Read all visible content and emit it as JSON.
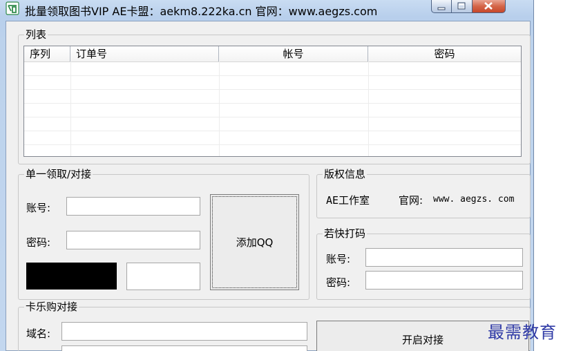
{
  "window": {
    "title": "批量领取图书VIP  AE卡盟：aekm8.222ka.cn  官网：www.aegzs.com",
    "min_icon": "minimize-icon",
    "max_icon": "maximize-icon",
    "close_icon": "close-icon",
    "app_icon": "app-logo-icon"
  },
  "list_group": {
    "legend": "列表",
    "columns": [
      "序列",
      "订单号",
      "帐号",
      "密码"
    ]
  },
  "single_group": {
    "legend": "单一领取/对接",
    "account_label": "账号:",
    "account_value": "",
    "password_label": "密码:",
    "password_value": "",
    "captcha_value": "",
    "add_button": "添加QQ"
  },
  "copyright_group": {
    "legend": "版权信息",
    "studio": "AE工作室",
    "site_label": "官网:",
    "site_url": "www. aegzs. com"
  },
  "ruokuai_group": {
    "legend": "若快打码",
    "account_label": "账号:",
    "account_value": "",
    "password_label": "密码:",
    "password_value": ""
  },
  "kalegou_group": {
    "legend": "卡乐购对接",
    "domain_label": "域名:",
    "domain_value": "",
    "start_button": "开启对接"
  },
  "watermark": "最需教育",
  "colors": {
    "title_gradient_top": "#c9dcf2",
    "client_bg": "#f0f0f0",
    "close_red": "#d46649",
    "captcha_black": "#000000",
    "watermark_blue": "#2f3aa6"
  }
}
